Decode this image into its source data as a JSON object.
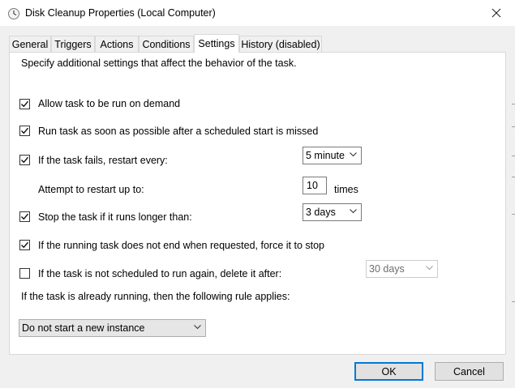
{
  "window": {
    "title": "Disk Cleanup Properties (Local Computer)"
  },
  "tabs": [
    {
      "label": "General"
    },
    {
      "label": "Triggers"
    },
    {
      "label": "Actions"
    },
    {
      "label": "Conditions"
    },
    {
      "label": "Settings"
    },
    {
      "label": "History (disabled)"
    }
  ],
  "active_tab": "Settings",
  "settings": {
    "intro": "Specify additional settings that affect the behavior of the task.",
    "allow_on_demand": {
      "label": "Allow task to be run on demand",
      "checked": true
    },
    "run_asap": {
      "label": "Run task as soon as possible after a scheduled start is missed",
      "checked": true
    },
    "restart_on_fail": {
      "label": "If the task fails, restart every:",
      "checked": true,
      "interval": "5 minute"
    },
    "restart_attempts": {
      "label": "Attempt to restart up to:",
      "value": "10",
      "suffix": "times"
    },
    "stop_if_longer": {
      "label": "Stop the task if it runs longer than:",
      "checked": true,
      "duration": "3 days"
    },
    "force_stop": {
      "label": "If the running task does not end when requested, force it to stop",
      "checked": true
    },
    "delete_after": {
      "label": "If the task is not scheduled to run again, delete it after:",
      "checked": false,
      "duration": "30 days"
    },
    "running_rule_label": "If the task is already running, then the following rule applies:",
    "running_rule": "Do not start a new instance"
  },
  "buttons": {
    "ok": "OK",
    "cancel": "Cancel"
  }
}
